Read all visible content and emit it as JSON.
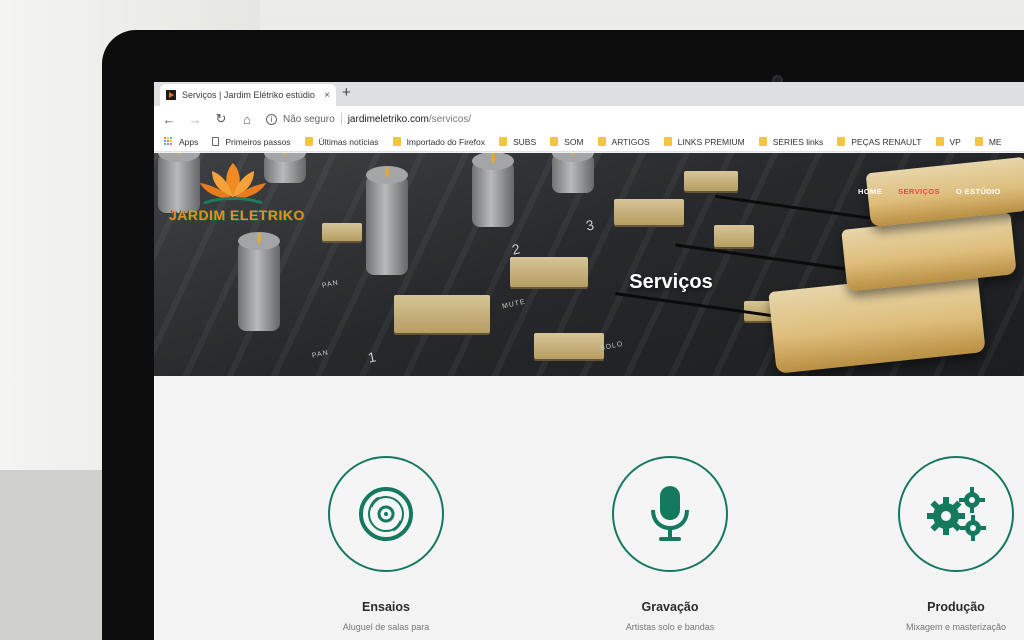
{
  "browser": {
    "tab_title": "Serviços | Jardim Elétriko estúdio",
    "tab_close": "×",
    "new_tab": "+",
    "nav": {
      "back": "←",
      "forward": "→",
      "reload": "↻",
      "home": "⌂"
    },
    "security_icon": "i",
    "security_label": "Não seguro",
    "url_host": "jardimeletriko.com",
    "url_path": "/servicos/",
    "bookmarks": [
      {
        "label": "Apps",
        "icon": "apps-icon"
      },
      {
        "label": "Primeiros passos",
        "icon": "page-icon"
      },
      {
        "label": "Últimas notícias",
        "icon": "folder-icon"
      },
      {
        "label": "Importado do Firefox",
        "icon": "folder-icon"
      },
      {
        "label": "SUBS",
        "icon": "folder-icon"
      },
      {
        "label": "SOM",
        "icon": "folder-icon"
      },
      {
        "label": "ARTIGOS",
        "icon": "folder-icon"
      },
      {
        "label": "LINKS PREMIUM",
        "icon": "folder-icon"
      },
      {
        "label": "SERIES links",
        "icon": "folder-icon"
      },
      {
        "label": "PEÇAS RENAULT",
        "icon": "folder-icon"
      },
      {
        "label": "VP",
        "icon": "folder-icon"
      },
      {
        "label": "ME",
        "icon": "folder-icon"
      }
    ]
  },
  "site": {
    "logo_text": "JARDIM ELETRIKO",
    "nav": [
      {
        "label": "HOME",
        "active": false
      },
      {
        "label": "SERVIÇOS",
        "active": true
      },
      {
        "label": "O ESTÚDIO",
        "active": false
      }
    ],
    "hero_title": "Serviços",
    "mixer_labels": [
      "PAN",
      "MUTE",
      "SOLO",
      "2",
      "3",
      "1",
      "PAN"
    ],
    "services": [
      {
        "title": "Ensaios",
        "desc": "Aluguel de salas para",
        "icon": "disc-icon"
      },
      {
        "title": "Gravação",
        "desc": "Artistas solo e bandas",
        "icon": "microphone-icon"
      },
      {
        "title": "Produção",
        "desc": "Mixagem e masterização",
        "icon": "gears-icon"
      }
    ]
  },
  "colors": {
    "accent": "#14795f",
    "active_nav": "#e24a4a",
    "logo_orange": "#f08a1f",
    "bezel": "#0d0d0e"
  }
}
